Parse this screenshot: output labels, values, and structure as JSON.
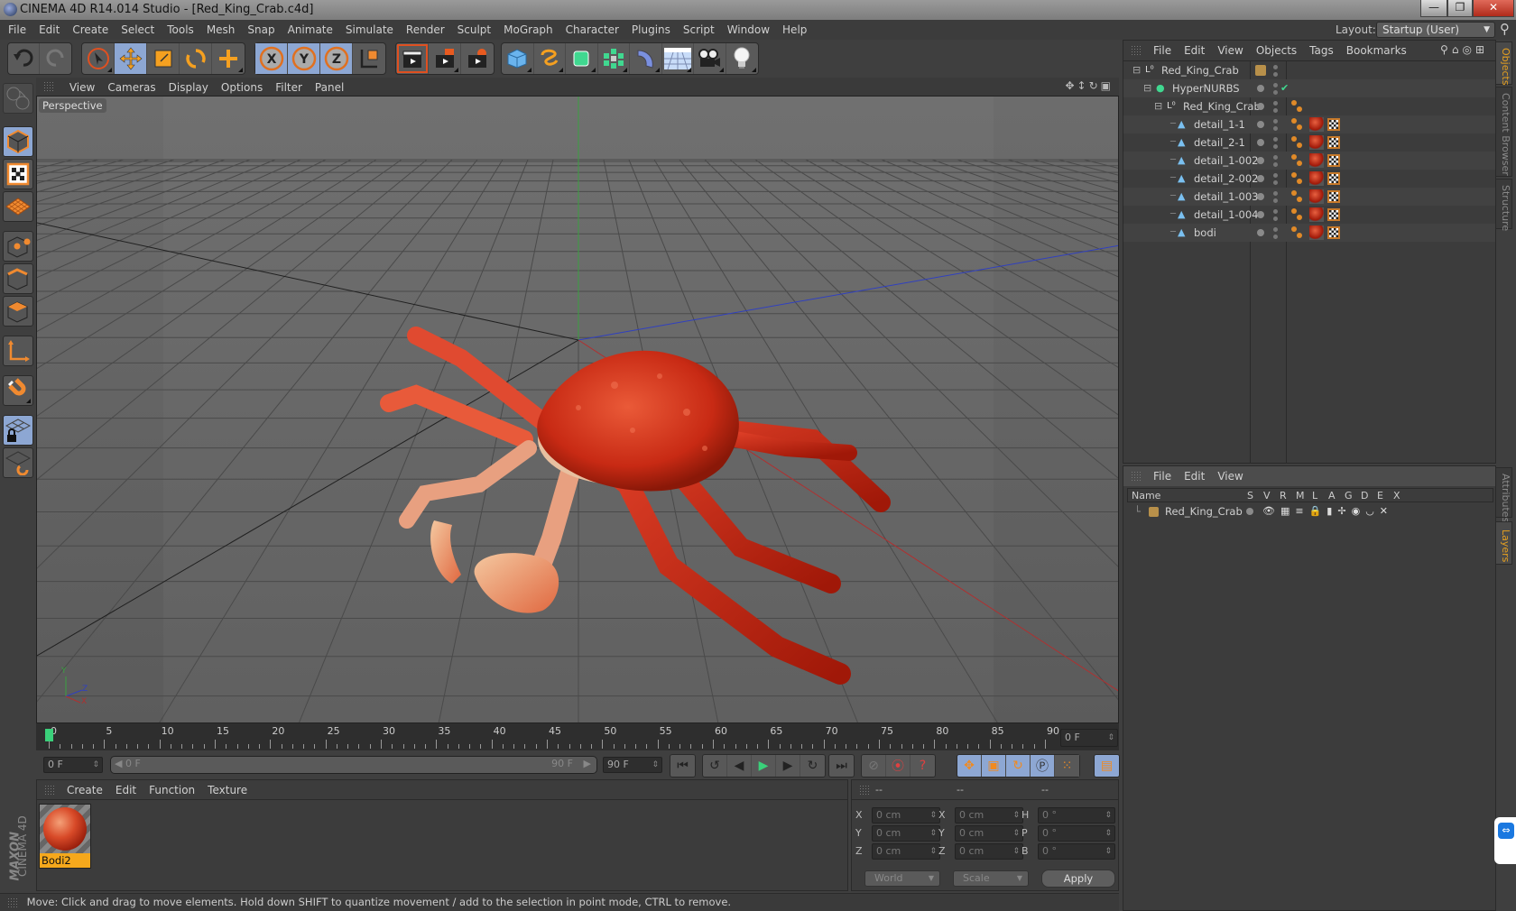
{
  "window": {
    "title": "CINEMA 4D R14.014 Studio - [Red_King_Crab.c4d]",
    "controls": {
      "minimize": "—",
      "restore": "❐",
      "close": "✕"
    }
  },
  "menubar": {
    "items": [
      "File",
      "Edit",
      "Create",
      "Select",
      "Tools",
      "Mesh",
      "Snap",
      "Animate",
      "Simulate",
      "Render",
      "Sculpt",
      "MoGraph",
      "Character",
      "Plugins",
      "Script",
      "Window",
      "Help"
    ]
  },
  "layout": {
    "label": "Layout:",
    "value": "Startup (User)"
  },
  "toolbar": {
    "history": [
      "undo-icon",
      "redo-icon"
    ],
    "tools": [
      "live-selection-icon",
      "move-icon",
      "scale-icon",
      "rotate-icon",
      "add-icon"
    ],
    "axes": [
      "X",
      "Y",
      "Z",
      "coordinate-system-icon"
    ],
    "render": [
      "render-view-icon",
      "render-picture-viewer-icon",
      "edit-render-settings-icon"
    ],
    "objects": [
      "cube-icon",
      "spline-pen-icon",
      "subdivision-surface-icon",
      "mograph-cloner-icon",
      "deformer-bend-icon",
      "floor-icon",
      "camera-icon",
      "light-icon"
    ]
  },
  "left_tools": [
    "convert-icon",
    "model-mode-icon",
    "texture-mode-icon",
    "workplane-icon",
    "points-mode-icon",
    "edges-mode-icon",
    "polygons-mode-icon",
    "axis-icon",
    "magnet-snap-icon",
    "lock-workplane-icon",
    "workplane-cycle-icon"
  ],
  "viewport": {
    "menu": [
      "View",
      "Cameras",
      "Display",
      "Options",
      "Filter",
      "Panel"
    ],
    "label": "Perspective",
    "axis_gizmo": {
      "x": "X",
      "y": "Y",
      "z": "Z"
    }
  },
  "timeline": {
    "ticks": [
      "0",
      "5",
      "10",
      "15",
      "20",
      "25",
      "30",
      "35",
      "40",
      "45",
      "50",
      "55",
      "60",
      "65",
      "70",
      "75",
      "80",
      "85",
      "90"
    ],
    "current_frame_field": "0 F",
    "current_position": 0,
    "end": 90
  },
  "transport": {
    "start_field": "0 F",
    "range_start": "0 F",
    "range_end": "90 F",
    "end_field": "90 F"
  },
  "material_manager": {
    "menu": [
      "Create",
      "Edit",
      "Function",
      "Texture"
    ],
    "materials": [
      {
        "name": "Bodi2",
        "selected": true
      }
    ]
  },
  "coordinates": {
    "headers": [
      "--",
      "--",
      "--"
    ],
    "rows": [
      {
        "l1": "X",
        "v1": "0 cm",
        "l2": "X",
        "v2": "0 cm",
        "l3": "H",
        "v3": "0 °"
      },
      {
        "l1": "Y",
        "v1": "0 cm",
        "l2": "Y",
        "v2": "0 cm",
        "l3": "P",
        "v3": "0 °"
      },
      {
        "l1": "Z",
        "v1": "0 cm",
        "l2": "Z",
        "v2": "0 cm",
        "l3": "B",
        "v3": "0 °"
      }
    ],
    "space": "World",
    "mode": "Scale",
    "apply": "Apply"
  },
  "object_manager": {
    "menu": [
      "File",
      "Edit",
      "View",
      "Objects",
      "Tags",
      "Bookmarks"
    ],
    "objects": [
      {
        "name": "Red_King_Crab",
        "type": "null",
        "depth": 0,
        "tags": []
      },
      {
        "name": "HyperNURBS",
        "type": "hypernurbs",
        "depth": 1,
        "tags": [],
        "enabled": true
      },
      {
        "name": "Red_King_Crab",
        "type": "null",
        "depth": 2,
        "tags": [
          "phong"
        ]
      },
      {
        "name": "detail_1-1",
        "type": "polygon",
        "depth": 3,
        "tags": [
          "phong",
          "material",
          "uvw"
        ]
      },
      {
        "name": "detail_2-1",
        "type": "polygon",
        "depth": 3,
        "tags": [
          "phong",
          "material",
          "uvw"
        ]
      },
      {
        "name": "detail_1-002",
        "type": "polygon",
        "depth": 3,
        "tags": [
          "phong",
          "material",
          "uvw"
        ]
      },
      {
        "name": "detail_2-002",
        "type": "polygon",
        "depth": 3,
        "tags": [
          "phong",
          "material",
          "uvw"
        ]
      },
      {
        "name": "detail_1-003",
        "type": "polygon",
        "depth": 3,
        "tags": [
          "phong",
          "material",
          "uvw"
        ]
      },
      {
        "name": "detail_1-004",
        "type": "polygon",
        "depth": 3,
        "tags": [
          "phong",
          "material",
          "uvw"
        ]
      },
      {
        "name": "bodi",
        "type": "polygon",
        "depth": 3,
        "tags": [
          "phong",
          "material",
          "uvw"
        ]
      }
    ]
  },
  "layer_manager": {
    "menu": [
      "File",
      "Edit",
      "View"
    ],
    "columns": [
      "Name",
      "S",
      "V",
      "R",
      "M",
      "L",
      "A",
      "G",
      "D",
      "E",
      "X"
    ],
    "layers": [
      {
        "name": "Red_King_Crab",
        "color": "#b8904a"
      }
    ]
  },
  "side_tabs": {
    "top": [
      {
        "label": "Objects",
        "active": true
      },
      {
        "label": "Content Browser",
        "active": false
      },
      {
        "label": "Structure",
        "active": false
      }
    ],
    "bottom": [
      {
        "label": "Attributes",
        "active": false
      },
      {
        "label": "Layers",
        "active": true
      }
    ]
  },
  "branding": {
    "maxon": "MAXON",
    "product": "CINEMA 4D"
  },
  "status": "Move: Click and drag to move elements. Hold down SHIFT to quantize movement / add to the selection in point mode, CTRL to remove.",
  "colors": {
    "accent": "#e6a020",
    "active_tool": "#8da7d3",
    "timeline_marker": "#3ad07a"
  }
}
